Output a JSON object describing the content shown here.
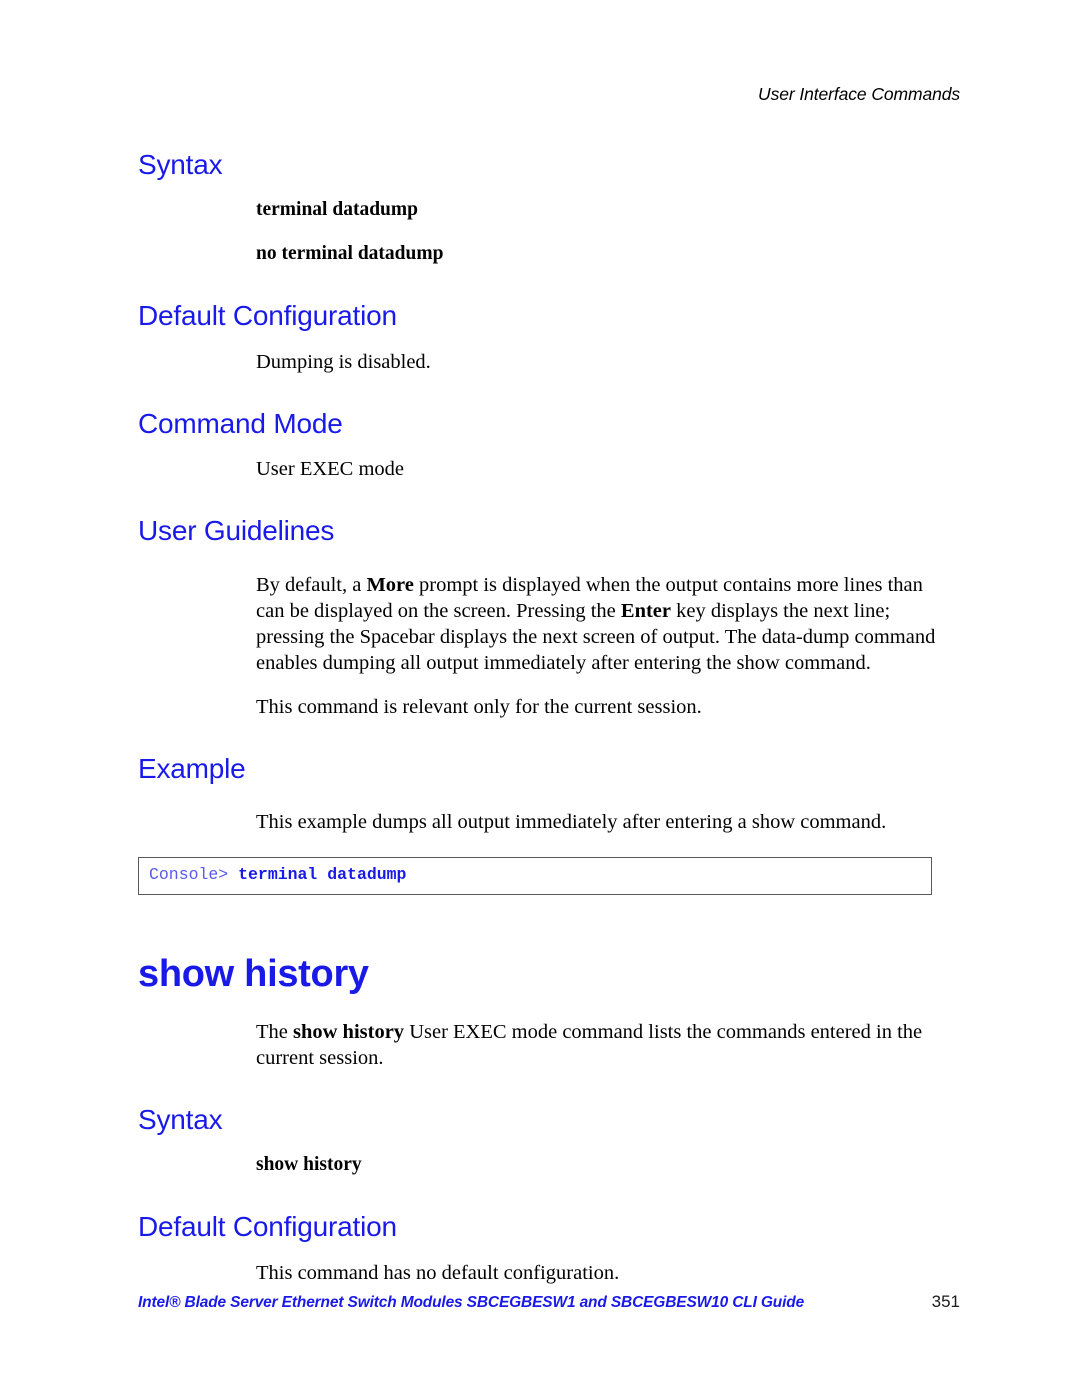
{
  "header": {
    "running_head": "User Interface Commands"
  },
  "sections": {
    "syntax_1": {
      "heading": "Syntax",
      "line_1": "terminal datadump",
      "line_2": "no terminal datadump"
    },
    "default_config_1": {
      "heading": "Default Configuration",
      "body": "Dumping is disabled."
    },
    "command_mode": {
      "heading": "Command Mode",
      "body": "User EXEC mode"
    },
    "user_guidelines": {
      "heading": "User Guidelines",
      "para_1_part_1": "By default, a ",
      "para_1_bold_1": "More",
      "para_1_part_2": " prompt is displayed when the output contains more lines than can be displayed on the screen. Pressing the ",
      "para_1_bold_2": "Enter",
      "para_1_part_3": " key displays the next line; pressing the Spacebar displays the next screen of output. The data-dump command enables dumping all output immediately after entering the show command.",
      "para_2": "This command is relevant only for the current session."
    },
    "example": {
      "heading": "Example",
      "body": "This example dumps all output immediately after entering a show command.",
      "console_prompt": "Console> ",
      "console_command": "terminal datadump"
    },
    "show_history": {
      "title": "show history",
      "intro_part_1": "The ",
      "intro_bold": "show history",
      "intro_part_2": " User EXEC mode command lists the commands entered in the current session."
    },
    "syntax_2": {
      "heading": "Syntax",
      "line_1": "show history"
    },
    "default_config_2": {
      "heading": "Default Configuration",
      "body": "This command has no default configuration."
    }
  },
  "footer": {
    "guide_text": "Intel® Blade Server Ethernet Switch Modules SBCEGBESW1 and SBCEGBESW10 CLI Guide",
    "page_number": "351"
  },
  "colors": {
    "heading_blue": "#1a1ae8",
    "console_border": "#5a5a5a",
    "body_black": "#000000"
  }
}
